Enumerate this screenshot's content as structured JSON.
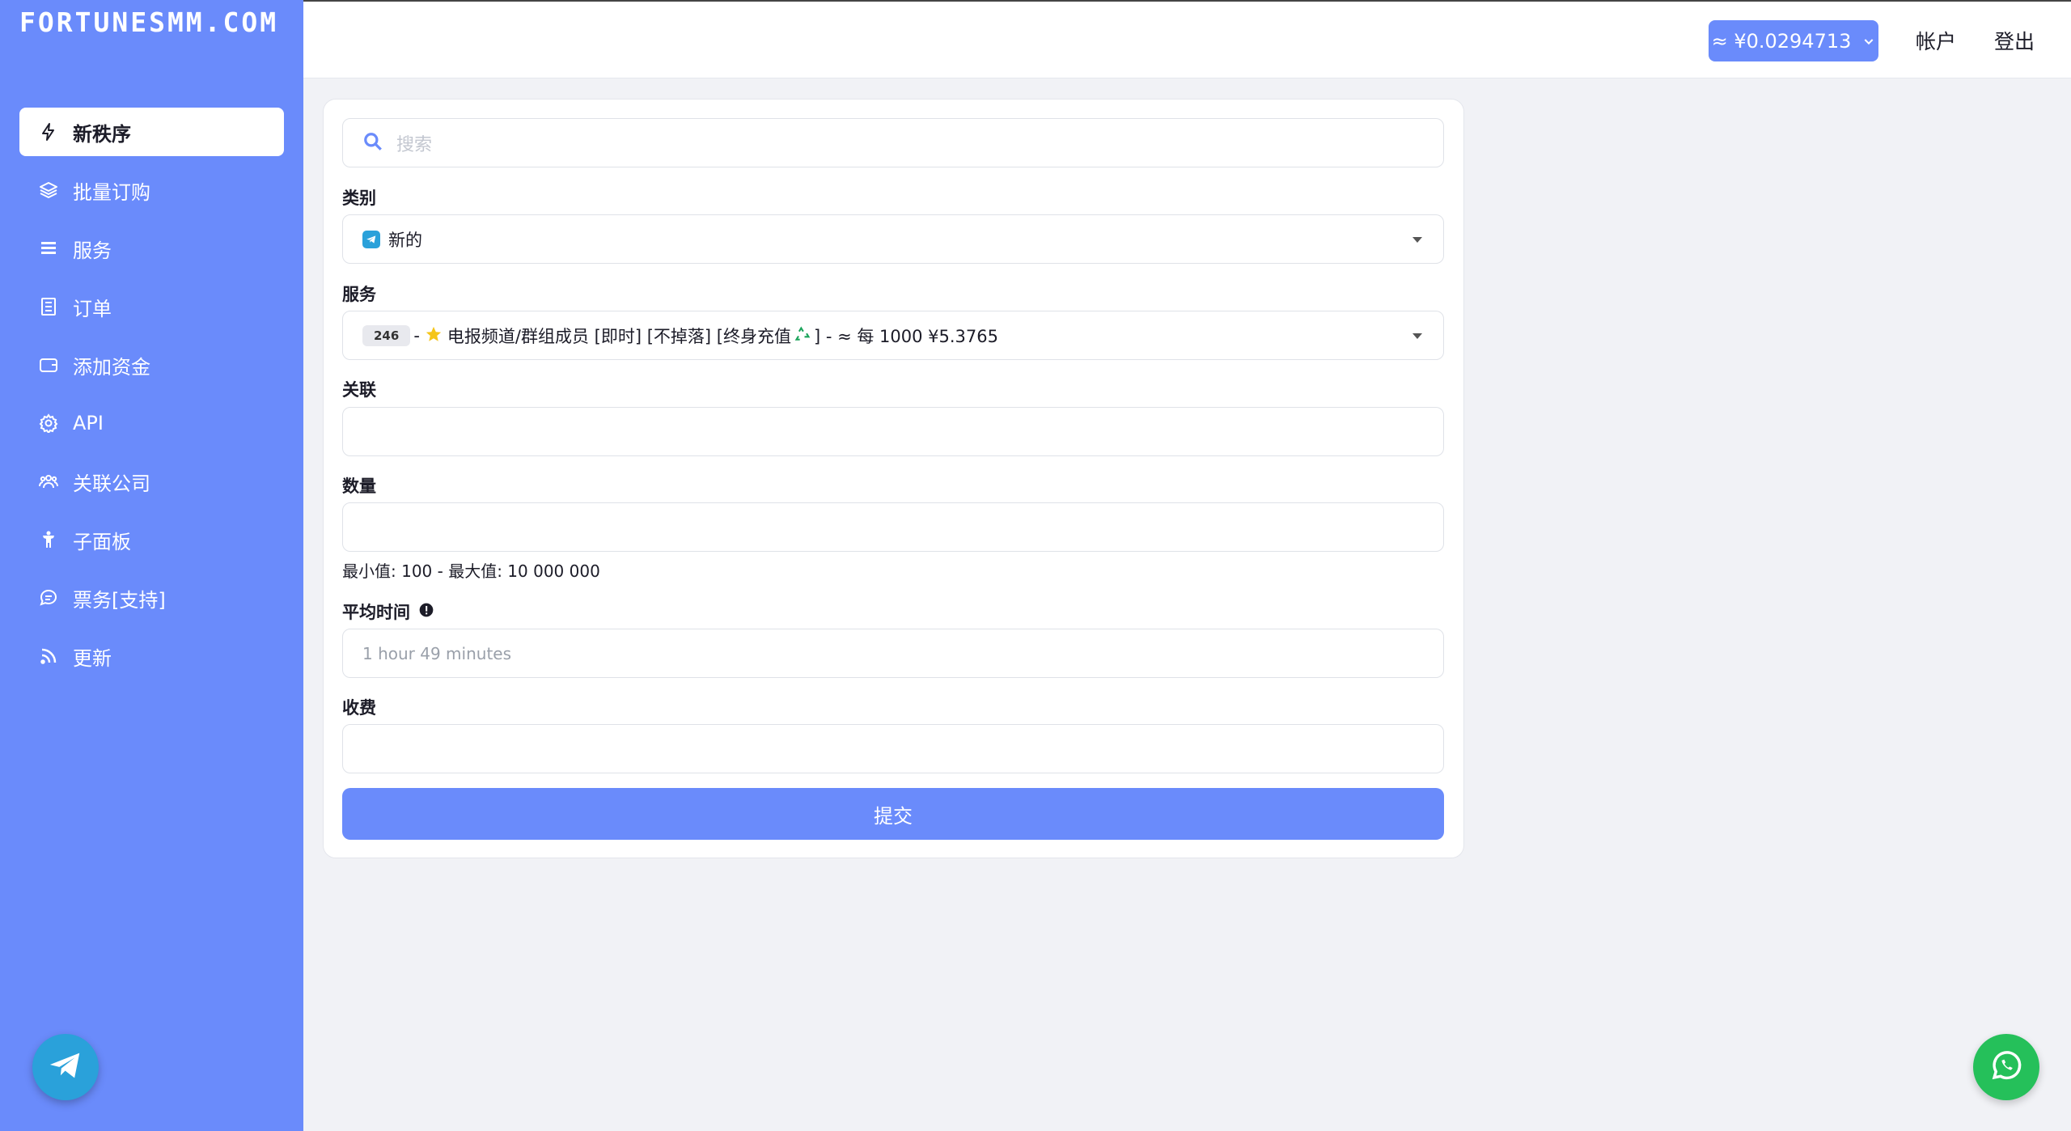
{
  "brand": "FORTUNESMM.COM",
  "nav": [
    {
      "label": "新秩序",
      "icon": "bolt-icon"
    },
    {
      "label": "批量订购",
      "icon": "layers-icon"
    },
    {
      "label": "服务",
      "icon": "list-icon"
    },
    {
      "label": "订单",
      "icon": "receipt-icon"
    },
    {
      "label": "添加资金",
      "icon": "wallet-icon"
    },
    {
      "label": "API",
      "icon": "cog-icon"
    },
    {
      "label": "关联公司",
      "icon": "users-icon"
    },
    {
      "label": "子面板",
      "icon": "child-icon"
    },
    {
      "label": "票务[支持]",
      "icon": "chat-icon"
    },
    {
      "label": "更新",
      "icon": "rss-icon"
    }
  ],
  "topbar": {
    "balance": "≈ ¥0.0294713",
    "account": "帐户",
    "logout": "登出"
  },
  "form": {
    "search_placeholder": "搜索",
    "category_label": "类别",
    "category_value": "新的",
    "service_label": "服务",
    "service_id": "246",
    "service_text": "电报频道/群组成员 [即时] [不掉落] [终身充值",
    "service_price": "] - ≈ 每 1000 ¥5.3765",
    "link_label": "关联",
    "quantity_label": "数量",
    "quantity_hint": "最小值: 100 - 最大值: 10 000 000",
    "avg_time_label": "平均时间",
    "avg_time_value": "1 hour 49 minutes",
    "charge_label": "收费",
    "submit_label": "提交"
  },
  "colors": {
    "accent": "#6a8bfb",
    "telegram": "#2aa1da",
    "whatsapp": "#25c05a"
  }
}
